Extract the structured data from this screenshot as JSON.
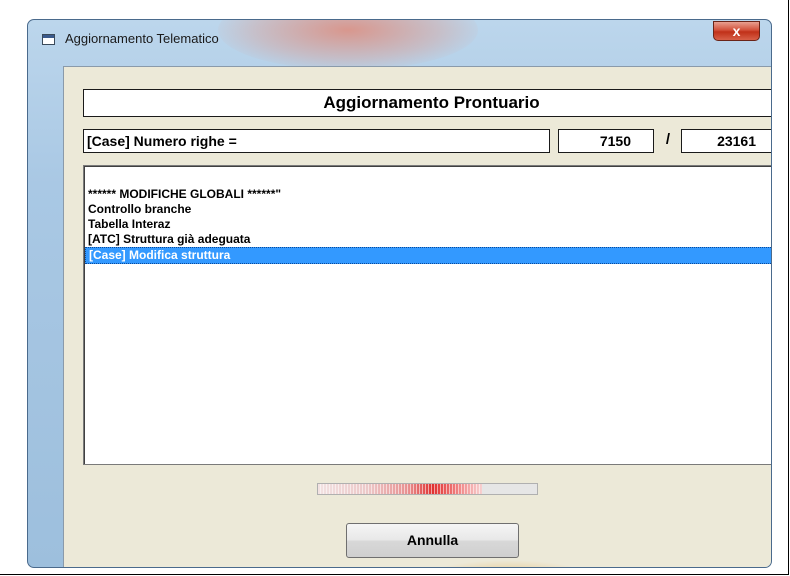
{
  "window": {
    "title": "Aggiornamento Telematico",
    "close_glyph": "x",
    "close_icon": "close-icon",
    "app_icon": "window-app-icon"
  },
  "header": {
    "title": "Aggiornamento Prontuario"
  },
  "counter": {
    "label": "[Case] Numero righe =",
    "current": "7150",
    "separator": "/",
    "total": "23161"
  },
  "log": {
    "items": [
      {
        "text": "****** MODIFICHE GLOBALI ******\"",
        "selected": false
      },
      {
        "text": "Controllo branche",
        "selected": false
      },
      {
        "text": "Tabella Interaz",
        "selected": false
      },
      {
        "text": "[ATC] Struttura già adeguata",
        "selected": false
      },
      {
        "text": "[Case] Modifica struttura",
        "selected": true
      }
    ]
  },
  "progress": {
    "fraction": 0.75,
    "bar_color": "#e03030"
  },
  "buttons": {
    "cancel_label": "Annulla"
  },
  "colors": {
    "selection": "#3399ff",
    "dialog_bg": "#ece9d8",
    "close_button": "#c03018"
  }
}
